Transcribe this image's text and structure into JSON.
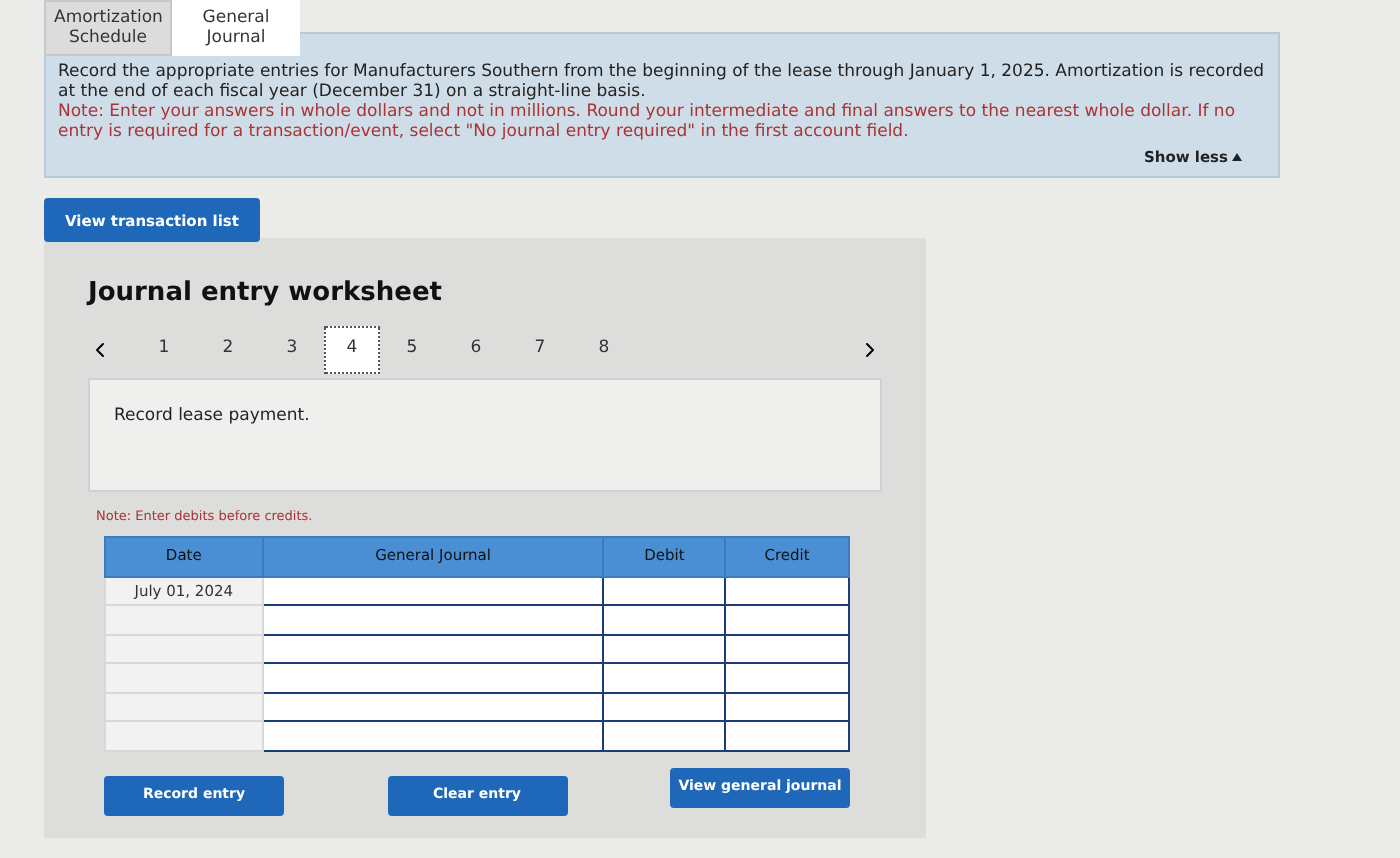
{
  "tabs": [
    {
      "label": "Amortization Schedule",
      "selected": false
    },
    {
      "label": "General Journal",
      "selected": true
    }
  ],
  "instructions": {
    "text": "Record the appropriate entries for Manufacturers Southern from the beginning of the lease through January 1, 2025. Amortization is recorded at the end of each fiscal year (December 31) on a straight-line basis.",
    "note": "Note: Enter your answers in whole dollars and not in millions. Round your intermediate and final answers to the nearest whole dollar. If no entry is required for a transaction/event, select \"No journal entry required\" in the first account field.",
    "toggle": "Show less"
  },
  "view_transaction_button": "View transaction list",
  "worksheet": {
    "title": "Journal entry worksheet",
    "pages": [
      {
        "label": "1",
        "selected": false
      },
      {
        "label": "2",
        "selected": false
      },
      {
        "label": "3",
        "selected": false
      },
      {
        "label": "4",
        "selected": true
      },
      {
        "label": "5",
        "selected": false
      },
      {
        "label": "6",
        "selected": false
      },
      {
        "label": "7",
        "selected": false
      },
      {
        "label": "8",
        "selected": false
      }
    ],
    "prompt": "Record lease payment.",
    "note": "Note: Enter debits before credits.",
    "table": {
      "columns": [
        "Date",
        "General Journal",
        "Debit",
        "Credit"
      ],
      "rows": [
        {
          "date": "July 01, 2024"
        },
        {},
        {},
        {},
        {},
        {}
      ]
    },
    "buttons": [
      "Record entry",
      "Clear entry",
      "View general journal"
    ]
  }
}
